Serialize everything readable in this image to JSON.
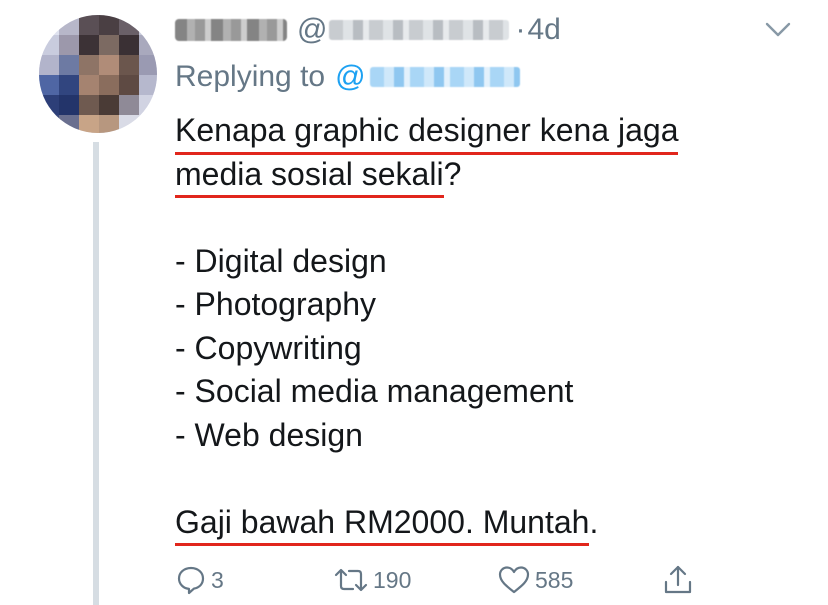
{
  "tweet": {
    "author": {
      "handle_prefix": "@",
      "timestamp": "4d",
      "separator": "·"
    },
    "replying": {
      "label": "Replying to",
      "at": "@"
    },
    "body": {
      "line1": "Kenapa graphic designer kena jaga",
      "line2": "media sosial sekali",
      "line2_q": "?",
      "items": [
        "- Digital design",
        "- Photography",
        "- Copywriting",
        "- Social media management",
        "- Web design"
      ],
      "closing": "Gaji bawah RM2000. Muntah",
      "closing_dot": "."
    },
    "actions": {
      "reply_count": "3",
      "retweet_count": "190",
      "like_count": "585"
    },
    "icons": {
      "reply": "reply-icon",
      "retweet": "retweet-icon",
      "like": "heart-icon",
      "share": "share-icon",
      "menu": "chevron-down-icon"
    },
    "colors": {
      "text": "#14171a",
      "secondary": "#657786",
      "link": "#1da1f2",
      "underline": "#e1261c",
      "thread": "#d6dde3"
    }
  }
}
